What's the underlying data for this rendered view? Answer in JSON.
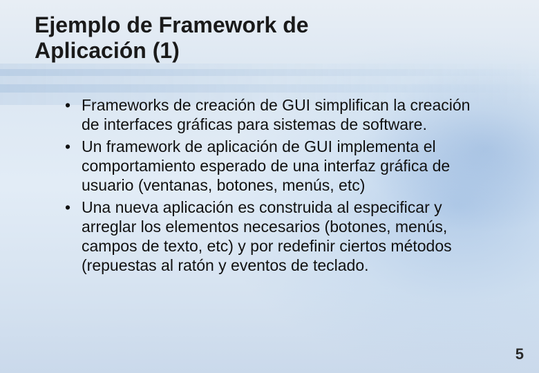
{
  "slide": {
    "title": "Ejemplo de Framework de Aplicación (1)",
    "bullets": [
      "Frameworks de creación de GUI simplifican la creación de interfaces gráficas para sistemas de software.",
      "Un framework de aplicación de GUI implementa el comportamiento esperado de una interfaz gráfica de usuario (ventanas, botones, menús, etc)",
      "Una nueva aplicación es construida al especificar y arreglar los elementos necesarios (botones, menús, campos de texto, etc) y por redefinir ciertos métodos (repuestas al ratón y eventos de teclado."
    ],
    "page_number": "5"
  }
}
